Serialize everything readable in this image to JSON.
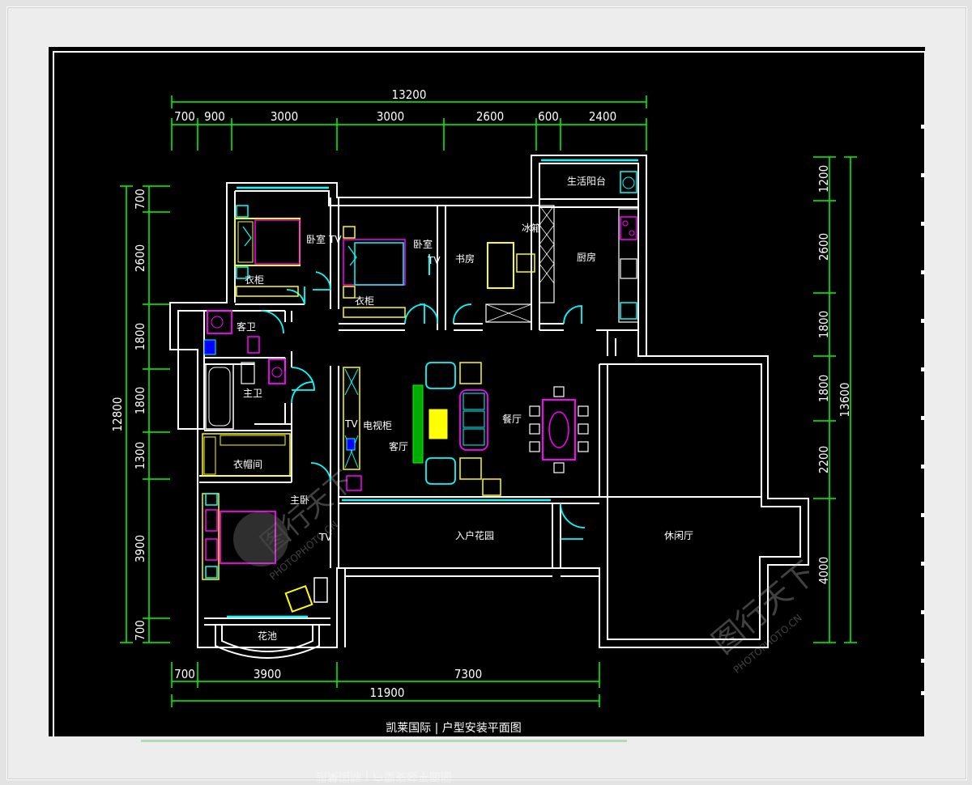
{
  "dimensions": {
    "top_total": "13200",
    "top_segments": [
      "700",
      "900",
      "3000",
      "3000",
      "2600",
      "600",
      "2400"
    ],
    "bottom_segments": [
      "700",
      "3900",
      "7300"
    ],
    "bottom_total": "11900",
    "left_total": "12800",
    "left_segments": [
      "700",
      "2600",
      "1800",
      "1800",
      "1300",
      "3900",
      "700"
    ],
    "right_total": "13600",
    "right_segments": [
      "1200",
      "2600",
      "1800",
      "1800",
      "2200",
      "4000"
    ]
  },
  "rooms": {
    "bedroom1": "卧室",
    "bedroom2": "卧室",
    "tv1": "TV",
    "tv2": "TV",
    "tv3": "TV",
    "tv4": "TV",
    "study": "书房",
    "kitchen": "厨房",
    "laundry_balcony": "生活阳台",
    "public_bath": "客卫",
    "master_bath": "主卫",
    "cloakroom": "衣帽间",
    "master_bedroom": "主卧",
    "flower_bay": "花池",
    "living_room": "客厅",
    "dining_room": "餐厅",
    "entry_garden": "入户花园",
    "leisure_hall": "休闲厅",
    "wardrobe_label": "衣柜",
    "cabinet_label": "电视柜",
    "fridge_label": "冰箱"
  },
  "caption": "凯莱国际 | 户型安装平面图",
  "watermark": {
    "brand": "图行天下",
    "sub": "PHOTOPHOTO.CN"
  },
  "colors": {
    "wall": "#ffffff",
    "dimension": "#00ff00",
    "furniture_yellow": "#ffff00",
    "furniture_cyan": "#00ffff",
    "furniture_magenta": "#ff00ff",
    "background": "#000000"
  }
}
